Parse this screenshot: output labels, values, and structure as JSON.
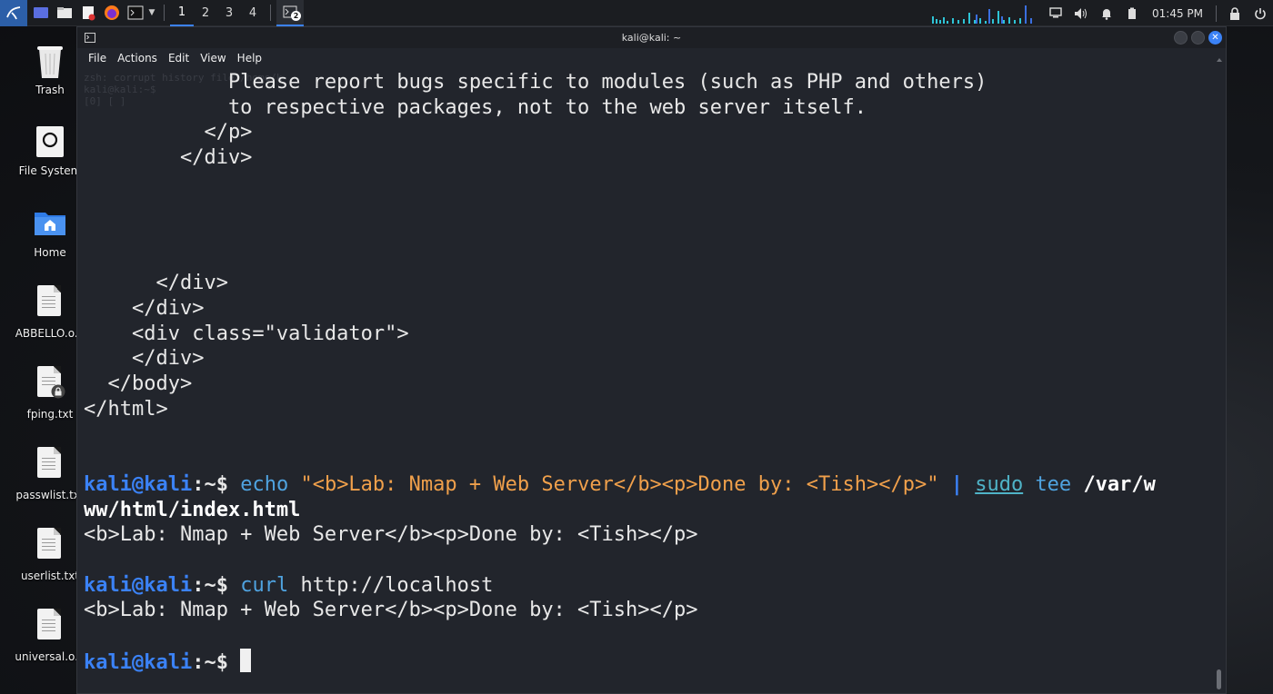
{
  "panel": {
    "workspaces": [
      "1",
      "2",
      "3",
      "4"
    ],
    "active_workspace": "1",
    "task_badge": "2",
    "clock": "01:45 PM",
    "icons": [
      "kali-menu-icon",
      "desktop-icon",
      "files-icon",
      "text-editor-icon",
      "firefox-icon",
      "terminal-icon"
    ]
  },
  "desktop": {
    "icons": [
      {
        "label": "Trash",
        "icon": "trash-icon"
      },
      {
        "label": "File System",
        "icon": "drive-icon"
      },
      {
        "label": "Home",
        "icon": "home-folder-icon"
      },
      {
        "label": "ABBELLO.o...",
        "icon": "document-icon"
      },
      {
        "label": "fping.txt",
        "icon": "locked-document-icon"
      },
      {
        "label": "passwlist.txt",
        "icon": "document-icon"
      },
      {
        "label": "userlist.txt",
        "icon": "document-icon"
      },
      {
        "label": "universal.o...",
        "icon": "document-icon"
      }
    ]
  },
  "terminal": {
    "title": "kali@kali: ~",
    "menu": [
      "File",
      "Actions",
      "Edit",
      "View",
      "Help"
    ],
    "ghost_lines": [
      "zsh: corrupt history file /home/k",
      "kali@kali:~$ ",
      "[0] [ ]"
    ],
    "output_lines": [
      "            Please report bugs specific to modules (such as PHP and others)",
      "            to respective packages, not to the web server itself.",
      "          </p>",
      "        </div>",
      "      </div>",
      "    </div>",
      "    <div class=\"validator\">",
      "    </div>",
      "  </body>",
      "</html>"
    ],
    "prompt_user": "kali@kali",
    "prompt_sep": ":",
    "prompt_path": "~$",
    "cmd1": {
      "command": "echo",
      "string": "\"<b>Lab: Nmap + Web Server</b><p>Done by: <Tish></p>\"",
      "pipe": "|",
      "sudo": "sudo",
      "tee": "tee",
      "path_part1": "/var/w",
      "path_part2": "ww/html/index.html",
      "output": "<b>Lab: Nmap + Web Server</b><p>Done by: <Tish></p>"
    },
    "cmd2": {
      "command": "curl",
      "arg": "http://localhost",
      "output": "<b>Lab: Nmap + Web Server</b><p>Done by: <Tish></p>"
    }
  }
}
